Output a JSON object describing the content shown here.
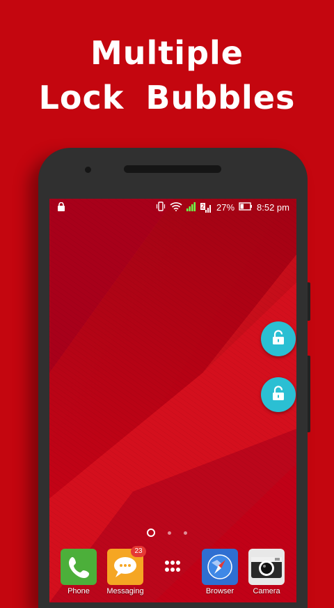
{
  "headline": {
    "line1": "Multiple",
    "line2": "Lock  Bubbles"
  },
  "status_bar": {
    "battery": "27%",
    "time": "8:52 pm",
    "sim_label": "2"
  },
  "lock_bubbles": [
    {
      "icon": "unlock-icon"
    },
    {
      "icon": "unlock-icon"
    }
  ],
  "home_pages": {
    "current": 1,
    "total": 3
  },
  "dock": {
    "apps": [
      {
        "label": "Phone",
        "icon": "phone-icon",
        "color": "#4caf3a"
      },
      {
        "label": "Messaging",
        "icon": "messaging-icon",
        "color": "#f5a623",
        "badge": "23"
      },
      {
        "label": "",
        "icon": "app-drawer-icon"
      },
      {
        "label": "Browser",
        "icon": "compass-icon",
        "color": "#2f6fd1"
      },
      {
        "label": "Camera",
        "icon": "camera-icon",
        "color": "#e8e8e8"
      }
    ]
  },
  "colors": {
    "background": "#c4060f",
    "bubble": "#2bbfd3",
    "phone_body": "#303030"
  }
}
